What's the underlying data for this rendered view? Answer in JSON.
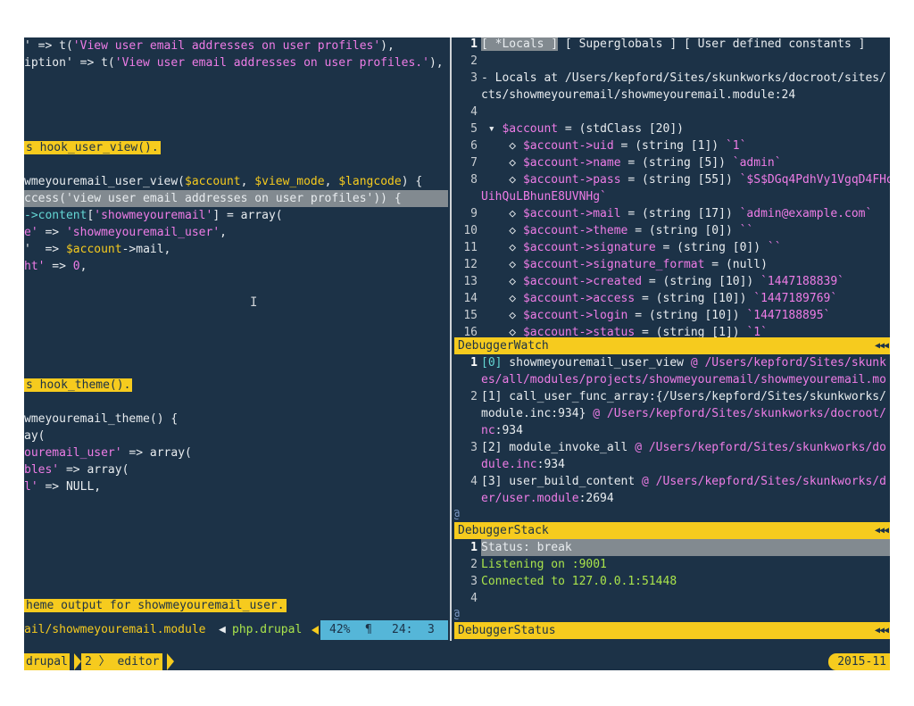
{
  "editor": {
    "lines": [
      {
        "segments": [
          {
            "t": "' => t(",
            "c": "w"
          },
          {
            "t": "'View user email addresses on user profiles'",
            "c": "p"
          },
          {
            "t": "),",
            "c": "w"
          }
        ]
      },
      {
        "segments": [
          {
            "t": "iption' => t(",
            "c": "w"
          },
          {
            "t": "'View user email addresses on user profiles.'",
            "c": "p"
          },
          {
            "t": "),",
            "c": "w"
          }
        ]
      },
      {
        "segments": []
      },
      {
        "segments": []
      },
      {
        "segments": []
      },
      {
        "segments": []
      },
      {
        "segments": [
          {
            "t": "s hook_user_view().",
            "c": "yel"
          }
        ]
      },
      {
        "segments": []
      },
      {
        "segments": [
          {
            "t": "wmeyouremail_user_view(",
            "c": "w"
          },
          {
            "t": "$account",
            "c": "y"
          },
          {
            "t": ", ",
            "c": "w"
          },
          {
            "t": "$view_mode",
            "c": "y"
          },
          {
            "t": ", ",
            "c": "w"
          },
          {
            "t": "$langcode",
            "c": "y"
          },
          {
            "t": ") {",
            "c": "w"
          }
        ]
      },
      {
        "hl": true,
        "segments": [
          {
            "t": "ccess(",
            "c": "w"
          },
          {
            "t": "'view user email addresses on user profiles'",
            "c": "w"
          },
          {
            "t": ")) {",
            "c": "w"
          }
        ]
      },
      {
        "segments": [
          {
            "t": "->content",
            "c": "c"
          },
          {
            "t": "[",
            "c": "w"
          },
          {
            "t": "'showmeyouremail'",
            "c": "p"
          },
          {
            "t": "] = array(",
            "c": "w"
          }
        ]
      },
      {
        "segments": [
          {
            "t": "e'",
            "c": "p"
          },
          {
            "t": " => ",
            "c": "w"
          },
          {
            "t": "'showmeyouremail_user'",
            "c": "p"
          },
          {
            "t": ",",
            "c": "w"
          }
        ]
      },
      {
        "segments": [
          {
            "t": "'  => ",
            "c": "w"
          },
          {
            "t": "$account",
            "c": "y"
          },
          {
            "t": "->mail,",
            "c": "w"
          }
        ]
      },
      {
        "segments": [
          {
            "t": "ht'",
            "c": "p"
          },
          {
            "t": " => ",
            "c": "w"
          },
          {
            "t": "0",
            "c": "p"
          },
          {
            "t": ",",
            "c": "w"
          }
        ]
      },
      {
        "segments": []
      },
      {
        "segments": []
      },
      {
        "segments": []
      },
      {
        "segments": []
      },
      {
        "segments": []
      },
      {
        "segments": []
      },
      {
        "segments": [
          {
            "t": "s hook_theme().",
            "c": "yel"
          }
        ]
      },
      {
        "segments": []
      },
      {
        "segments": [
          {
            "t": "wmeyouremail_theme() {",
            "c": "w"
          }
        ]
      },
      {
        "segments": [
          {
            "t": "ay(",
            "c": "w"
          }
        ]
      },
      {
        "segments": [
          {
            "t": "ouremail_user'",
            "c": "p"
          },
          {
            "t": " => array(",
            "c": "w"
          }
        ]
      },
      {
        "segments": [
          {
            "t": "bles'",
            "c": "p"
          },
          {
            "t": " => array(",
            "c": "w"
          }
        ]
      },
      {
        "segments": [
          {
            "t": "l'",
            "c": "p"
          },
          {
            "t": " => NULL,",
            "c": "w"
          }
        ]
      },
      {
        "segments": []
      },
      {
        "segments": []
      },
      {
        "segments": []
      },
      {
        "segments": []
      },
      {
        "segments": []
      },
      {
        "segments": []
      },
      {
        "segments": [
          {
            "t": "heme output for showmeyouremail_user.",
            "c": "yel"
          }
        ]
      }
    ],
    "status": {
      "file": "ail/showmeyouremail.module",
      "arrow": "◀",
      "filetype": "php.drupal",
      "percent": "42%",
      "pilcrow": "¶",
      "line": "24:",
      "col": "3"
    }
  },
  "locals": {
    "lines": [
      {
        "n": "1",
        "segments": [
          {
            "t": "[ *Locals ]",
            "c": "sel"
          },
          {
            "t": " [ Superglobals ] [ User defined constants ]",
            "c": "w"
          }
        ]
      },
      {
        "n": "2",
        "segments": []
      },
      {
        "n": "3",
        "segments": [
          {
            "t": "- Locals at /Users/kepford/Sites/skunkworks/docroot/sites/",
            "c": "w"
          }
        ]
      },
      {
        "n": "",
        "segments": [
          {
            "t": "cts/showmeyouremail/showmeyouremail.module:24",
            "c": "w"
          }
        ]
      },
      {
        "n": "4",
        "segments": []
      },
      {
        "n": "5",
        "segments": [
          {
            "t": " ▾ ",
            "c": "w"
          },
          {
            "t": "$account",
            "c": "p"
          },
          {
            "t": " = (stdClass [20])",
            "c": "w"
          }
        ]
      },
      {
        "n": "6",
        "segments": [
          {
            "t": "    ◇ ",
            "c": "w"
          },
          {
            "t": "$account->uid",
            "c": "p"
          },
          {
            "t": " = (string [1]) ",
            "c": "w"
          },
          {
            "t": "`1`",
            "c": "p"
          }
        ]
      },
      {
        "n": "7",
        "segments": [
          {
            "t": "    ◇ ",
            "c": "w"
          },
          {
            "t": "$account->name",
            "c": "p"
          },
          {
            "t": " = (string [5]) ",
            "c": "w"
          },
          {
            "t": "`admin`",
            "c": "p"
          }
        ]
      },
      {
        "n": "8",
        "segments": [
          {
            "t": "    ◇ ",
            "c": "w"
          },
          {
            "t": "$account->pass",
            "c": "p"
          },
          {
            "t": " = (string [55]) ",
            "c": "w"
          },
          {
            "t": "`$S$DGq4PdhVy1VgqD4FHo",
            "c": "p"
          }
        ]
      },
      {
        "n": "",
        "segments": [
          {
            "t": "UihQuLBhunE8UVNHg`",
            "c": "p"
          }
        ]
      },
      {
        "n": "9",
        "segments": [
          {
            "t": "    ◇ ",
            "c": "w"
          },
          {
            "t": "$account->mail",
            "c": "p"
          },
          {
            "t": " = (string [17]) ",
            "c": "w"
          },
          {
            "t": "`admin@example.com`",
            "c": "p"
          }
        ]
      },
      {
        "n": "10",
        "segments": [
          {
            "t": "    ◇ ",
            "c": "w"
          },
          {
            "t": "$account->theme",
            "c": "p"
          },
          {
            "t": " = (string [0]) ",
            "c": "w"
          },
          {
            "t": "``",
            "c": "p"
          }
        ]
      },
      {
        "n": "11",
        "segments": [
          {
            "t": "    ◇ ",
            "c": "w"
          },
          {
            "t": "$account->signature",
            "c": "p"
          },
          {
            "t": " = (string [0]) ",
            "c": "w"
          },
          {
            "t": "``",
            "c": "p"
          }
        ]
      },
      {
        "n": "12",
        "segments": [
          {
            "t": "    ◇ ",
            "c": "w"
          },
          {
            "t": "$account->signature_format",
            "c": "p"
          },
          {
            "t": " = (null)",
            "c": "w"
          }
        ]
      },
      {
        "n": "13",
        "segments": [
          {
            "t": "    ◇ ",
            "c": "w"
          },
          {
            "t": "$account->created",
            "c": "p"
          },
          {
            "t": " = (string [10]) ",
            "c": "w"
          },
          {
            "t": "`1447188839`",
            "c": "p"
          }
        ]
      },
      {
        "n": "14",
        "segments": [
          {
            "t": "    ◇ ",
            "c": "w"
          },
          {
            "t": "$account->access",
            "c": "p"
          },
          {
            "t": " = (string [10]) ",
            "c": "w"
          },
          {
            "t": "`1447189769`",
            "c": "p"
          }
        ]
      },
      {
        "n": "15",
        "segments": [
          {
            "t": "    ◇ ",
            "c": "w"
          },
          {
            "t": "$account->login",
            "c": "p"
          },
          {
            "t": " = (string [10]) ",
            "c": "w"
          },
          {
            "t": "`1447188895`",
            "c": "p"
          }
        ]
      },
      {
        "n": "16",
        "segments": [
          {
            "t": "    ◇ ",
            "c": "w"
          },
          {
            "t": "$account->status",
            "c": "p"
          },
          {
            "t": " = (string [1]) ",
            "c": "w"
          },
          {
            "t": "`1`",
            "c": "p"
          }
        ]
      }
    ],
    "bar_label": "DebuggerWatch"
  },
  "stack": {
    "lines": [
      {
        "n": "1",
        "segments": [
          {
            "t": "[0]",
            "c": "c"
          },
          {
            "t": " showmeyouremail_user_view ",
            "c": "w"
          },
          {
            "t": "@ /Users/kepford/Sites/skunk",
            "c": "p"
          }
        ]
      },
      {
        "n": "",
        "segments": [
          {
            "t": "es/all/modules/projects/showmeyouremail/showmeyouremail.mo",
            "c": "p"
          }
        ]
      },
      {
        "n": "2",
        "segments": [
          {
            "t": "[1] call_user_func_array:{/Users/kepford/Sites/skunkworks/",
            "c": "w"
          }
        ]
      },
      {
        "n": "",
        "segments": [
          {
            "t": "module.inc:934} ",
            "c": "w"
          },
          {
            "t": "@ /Users/kepford/Sites/skunkworks/docroot/",
            "c": "p"
          }
        ]
      },
      {
        "n": "",
        "segments": [
          {
            "t": "nc",
            "c": "p"
          },
          {
            "t": ":934",
            "c": "w"
          }
        ]
      },
      {
        "n": "3",
        "segments": [
          {
            "t": "[2] module_invoke_all ",
            "c": "w"
          },
          {
            "t": "@ /Users/kepford/Sites/skunkworks/do",
            "c": "p"
          }
        ]
      },
      {
        "n": "",
        "segments": [
          {
            "t": "dule.inc",
            "c": "p"
          },
          {
            "t": ":934",
            "c": "w"
          }
        ]
      },
      {
        "n": "4",
        "segments": [
          {
            "t": "[3] user_build_content ",
            "c": "w"
          },
          {
            "t": "@ /Users/kepford/Sites/skunkworks/d",
            "c": "p"
          }
        ]
      },
      {
        "n": "",
        "segments": [
          {
            "t": "er/user.module",
            "c": "p"
          },
          {
            "t": ":2694",
            "c": "w"
          }
        ]
      }
    ],
    "at_sign": "@",
    "bar_label": "DebuggerStack"
  },
  "debug_status": {
    "lines": [
      {
        "n": "1",
        "sel": true,
        "segments": [
          {
            "t": "Status: break",
            "c": "w"
          }
        ]
      },
      {
        "n": "2",
        "segments": [
          {
            "t": "Listening on :9001",
            "c": "g"
          }
        ]
      },
      {
        "n": "3",
        "segments": [
          {
            "t": "Connected to 127.0.0.1:51448",
            "c": "g"
          }
        ]
      },
      {
        "n": "4",
        "segments": []
      }
    ],
    "at_sign": "@",
    "bar_label": "DebuggerStatus"
  },
  "bar_arrows": "◀◀◀",
  "tmux": {
    "session": "drupal",
    "window": "2 〉 editor",
    "date": "2015-11"
  }
}
